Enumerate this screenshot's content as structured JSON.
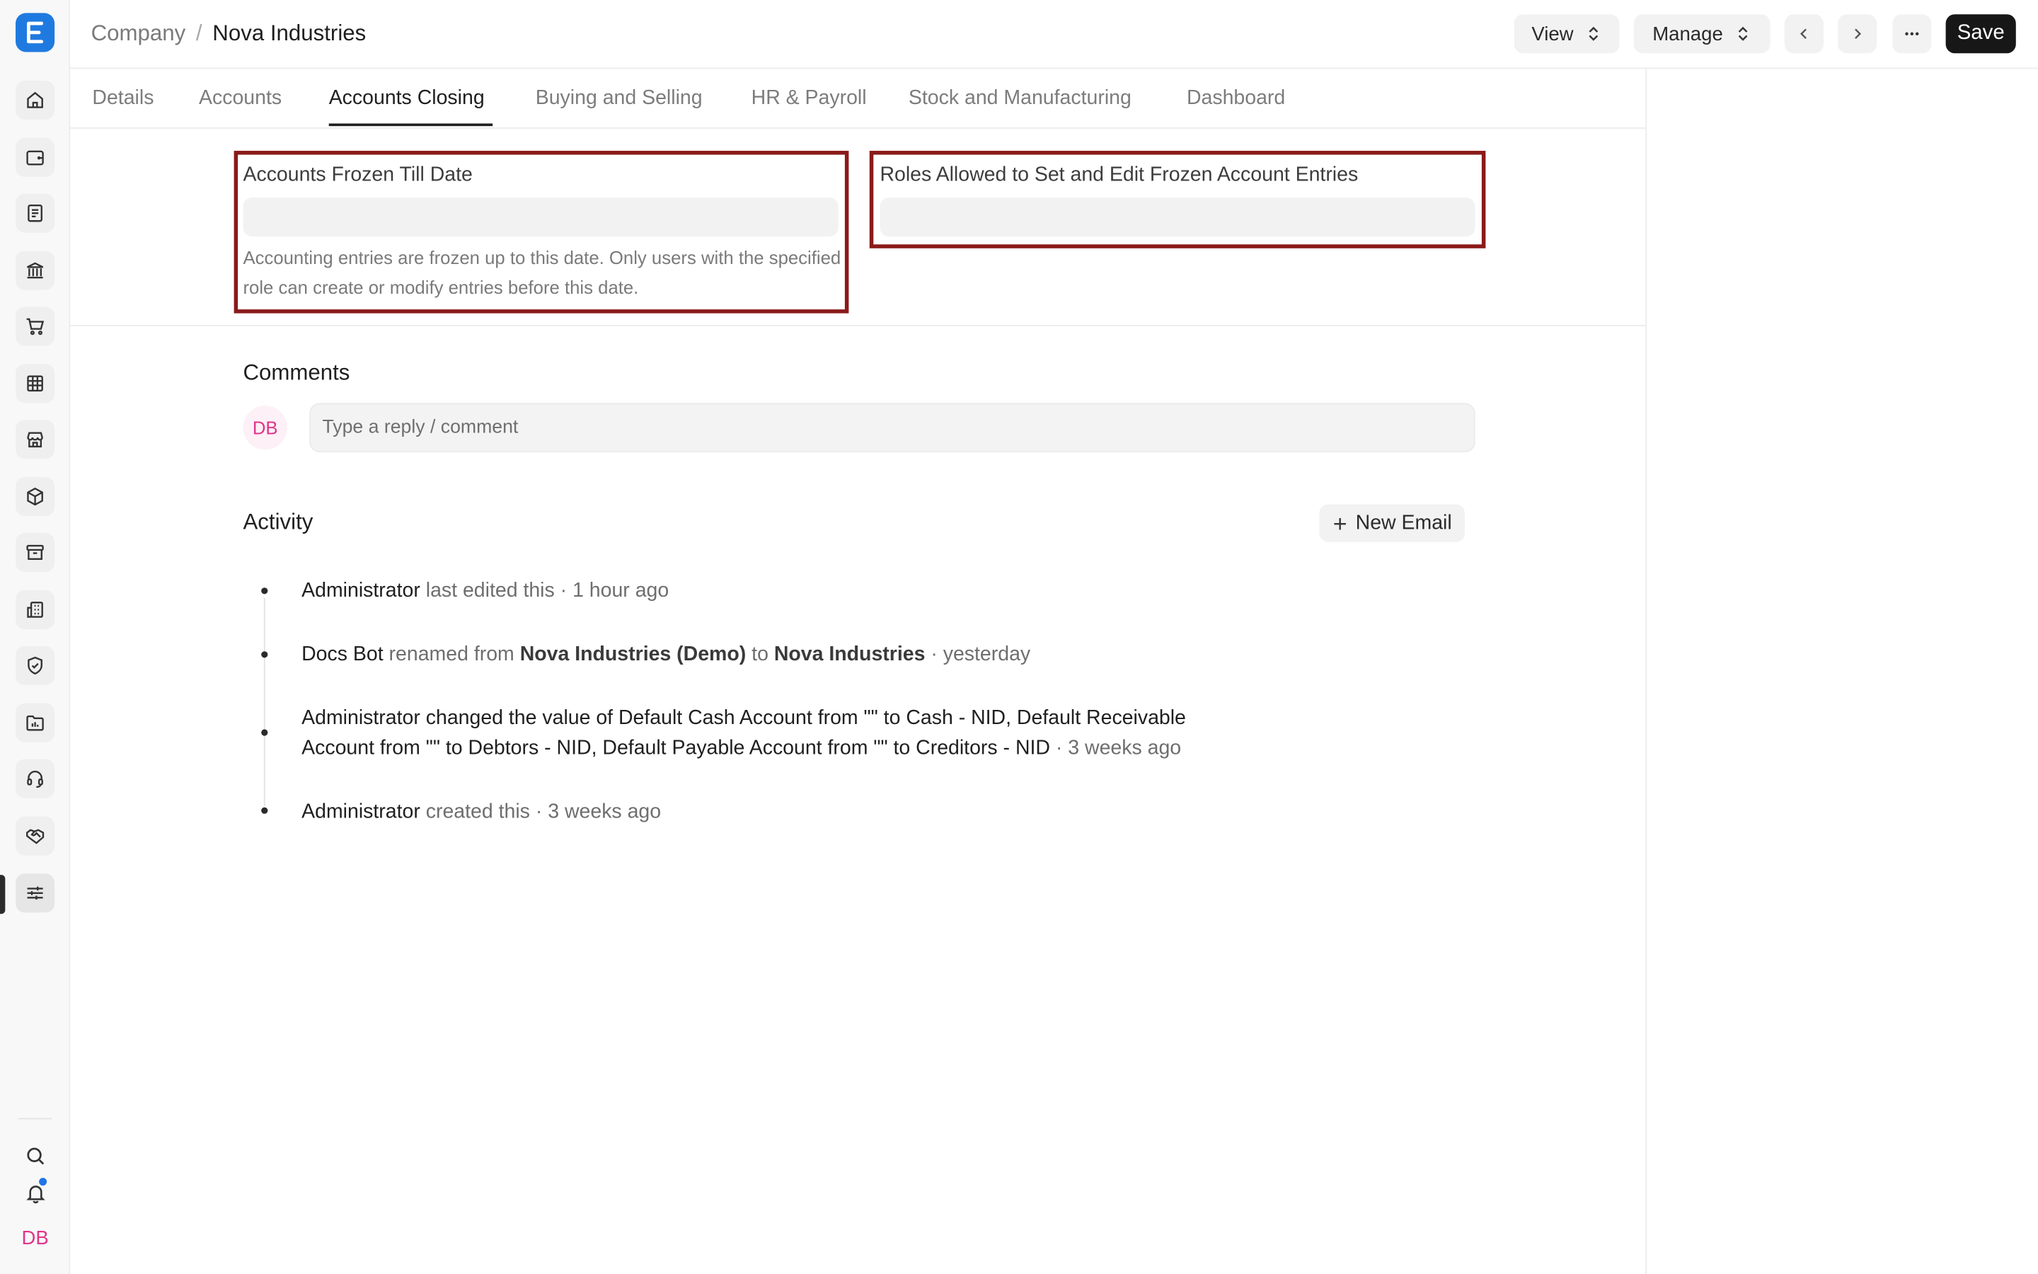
{
  "app": {
    "logo_letter": "E"
  },
  "breadcrumb": {
    "parent": "Company",
    "separator": "/",
    "current": "Nova Industries"
  },
  "header": {
    "view_label": "View",
    "manage_label": "Manage",
    "save_label": "Save"
  },
  "sidebar": {
    "icons": [
      "home-icon",
      "wallet-icon",
      "document-icon",
      "bank-icon",
      "cart-icon",
      "table-icon",
      "store-icon",
      "package-icon",
      "archive-icon",
      "building-icon",
      "shield-icon",
      "folder-icon",
      "headset-icon",
      "handshake-icon",
      "settings-sliders-icon"
    ],
    "active_icon": "settings-sliders-icon",
    "user_initials": "DB",
    "notification_dot_color": "#2474e6"
  },
  "tabs": [
    {
      "label": "Details"
    },
    {
      "label": "Accounts"
    },
    {
      "label": "Accounts Closing",
      "active": true
    },
    {
      "label": "Buying and Selling"
    },
    {
      "label": "HR & Payroll"
    },
    {
      "label": "Stock and Manufacturing"
    },
    {
      "label": "Dashboard"
    }
  ],
  "form": {
    "frozen_till": {
      "label": "Accounts Frozen Till Date",
      "value": "",
      "description": "Accounting entries are frozen up to this date. Only users with the specified role can create or modify entries before this date."
    },
    "frozen_roles": {
      "label": "Roles Allowed to Set and Edit Frozen Account Entries",
      "value": ""
    },
    "highlight_color": "#8b1a1a"
  },
  "comments": {
    "title": "Comments",
    "avatar_initials": "DB",
    "placeholder": "Type a reply / comment"
  },
  "activity": {
    "title": "Activity",
    "new_email_label": "New Email",
    "items": [
      {
        "who": "Administrator",
        "text": " last edited this",
        "time": " · 1 hour ago"
      },
      {
        "who": "Docs Bot",
        "pre": " renamed from ",
        "from": "Nova Industries (Demo)",
        "mid": " to ",
        "to": "Nova Industries",
        "time": " · yesterday"
      },
      {
        "who": "Administrator",
        "line1_pre": " changed the value of Default Cash Account from \"\" to ",
        "line1_val": "Cash - NID",
        "line1_post": ", Default Receivable",
        "line2_pre": "Account from \"\" to ",
        "line2_val1": "Debtors - NID",
        "line2_mid": ", Default Payable Account from \"\" to ",
        "line2_val2": "Creditors - NID",
        "time": " · 3 weeks ago"
      },
      {
        "who": "Administrator",
        "text": " created this",
        "time": " · 3 weeks ago"
      }
    ]
  }
}
